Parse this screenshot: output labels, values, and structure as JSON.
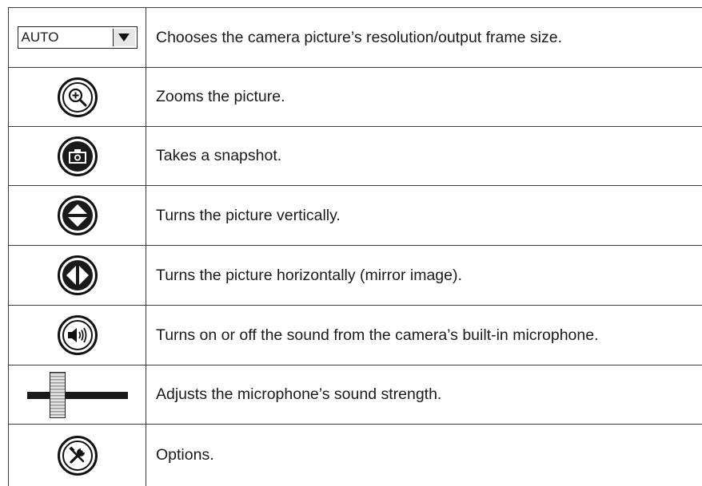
{
  "resolution_select": {
    "value": "AUTO",
    "icon": "chevron-down-icon"
  },
  "rows": [
    {
      "icon": "resolution-dropdown",
      "description": "Chooses the camera picture’s resolution/output frame size."
    },
    {
      "icon": "zoom-in-icon",
      "description": "Zooms the picture."
    },
    {
      "icon": "camera-icon",
      "description": "Takes a snapshot."
    },
    {
      "icon": "flip-vertical-icon",
      "description": "Turns the picture vertically."
    },
    {
      "icon": "flip-horizontal-icon",
      "description": "Turns the picture horizontally (mirror image)."
    },
    {
      "icon": "speaker-icon",
      "description": "Turns on or off the sound from the camera’s built-in microphone."
    },
    {
      "icon": "volume-slider",
      "description": "Adjusts the microphone’s sound strength."
    },
    {
      "icon": "tools-icon",
      "description": "Options."
    }
  ]
}
